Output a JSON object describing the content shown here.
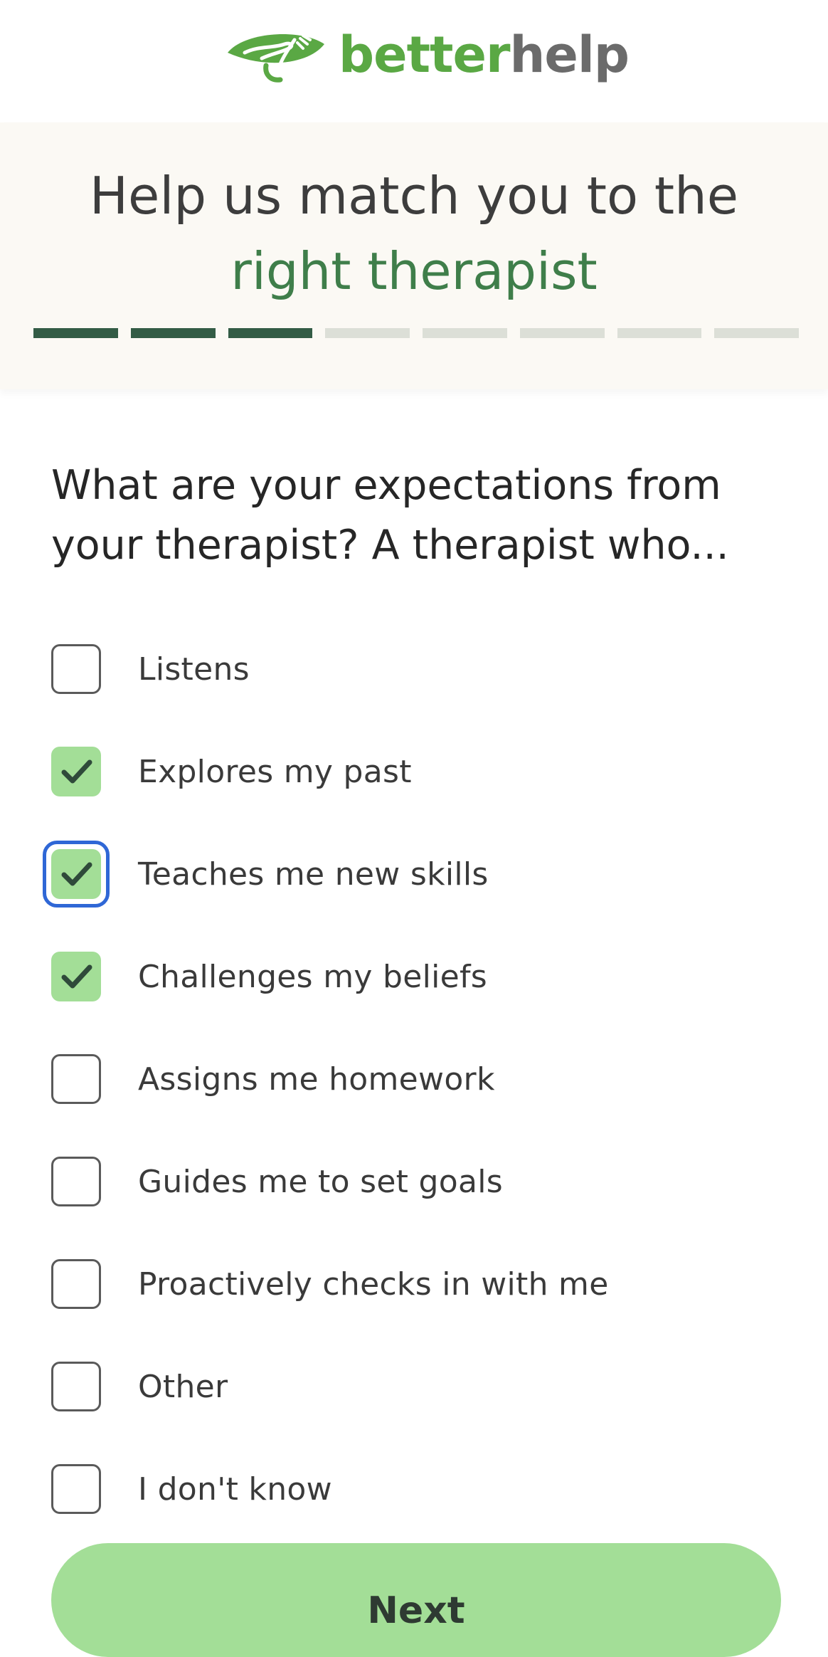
{
  "brand": {
    "name_part1": "better",
    "name_part2": "help",
    "logo_icon": "hands-leaf-icon",
    "green": "#5aa844",
    "grey": "#6b6b6b"
  },
  "banner": {
    "title_line1": "Help us match you to the",
    "title_line2": "right therapist",
    "progress": {
      "total_steps": 8,
      "completed_steps": 3,
      "done_color": "#335c45",
      "todo_color": "#dcdfd7"
    }
  },
  "question": {
    "text": "What are your expectations from your therapist? A therapist who..."
  },
  "options": [
    {
      "label": "Listens",
      "checked": false,
      "focused": false
    },
    {
      "label": "Explores my past",
      "checked": true,
      "focused": false
    },
    {
      "label": "Teaches me new skills",
      "checked": true,
      "focused": true
    },
    {
      "label": "Challenges my beliefs",
      "checked": true,
      "focused": false
    },
    {
      "label": "Assigns me homework",
      "checked": false,
      "focused": false
    },
    {
      "label": "Guides me to set goals",
      "checked": false,
      "focused": false
    },
    {
      "label": "Proactively checks in with me",
      "checked": false,
      "focused": false
    },
    {
      "label": "Other",
      "checked": false,
      "focused": false
    },
    {
      "label": "I don't know",
      "checked": false,
      "focused": false
    }
  ],
  "next_button": {
    "label": "Next",
    "color": "#a3de97"
  },
  "colors": {
    "checkbox_checked": "#a3de97",
    "checkmark": "#2f4a3a",
    "focus_ring": "#2f67d6",
    "title_accent": "#3f7e4a"
  }
}
